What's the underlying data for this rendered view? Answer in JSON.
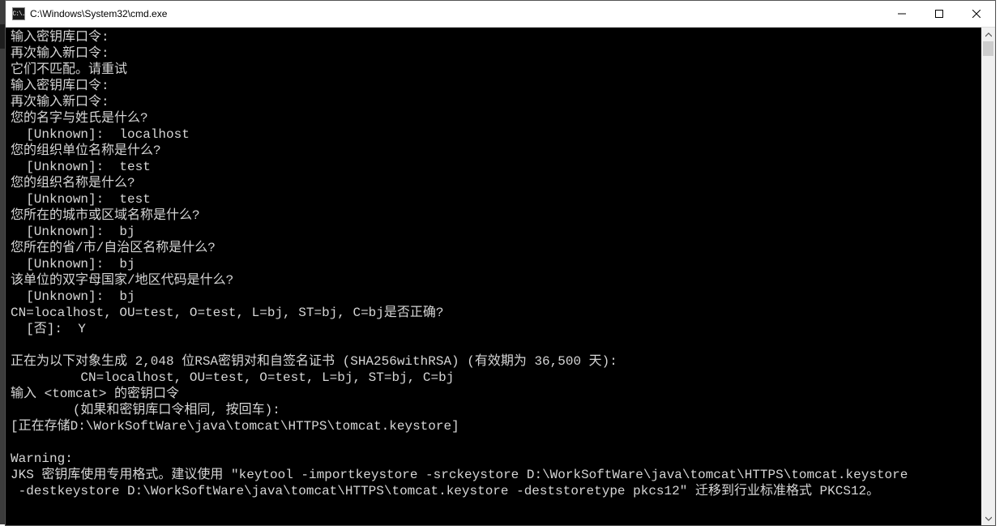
{
  "window": {
    "title": "C:\\Windows\\System32\\cmd.exe",
    "icon_label": "C:\\."
  },
  "terminal": {
    "lines": [
      "输入密钥库口令:",
      "再次输入新口令:",
      "它们不匹配。请重试",
      "输入密钥库口令:",
      "再次输入新口令:",
      "您的名字与姓氏是什么?",
      "  [Unknown]:  localhost",
      "您的组织单位名称是什么?",
      "  [Unknown]:  test",
      "您的组织名称是什么?",
      "  [Unknown]:  test",
      "您所在的城市或区域名称是什么?",
      "  [Unknown]:  bj",
      "您所在的省/市/自治区名称是什么?",
      "  [Unknown]:  bj",
      "该单位的双字母国家/地区代码是什么?",
      "  [Unknown]:  bj",
      "CN=localhost, OU=test, O=test, L=bj, ST=bj, C=bj是否正确?",
      "  [否]:  Y",
      "",
      "正在为以下对象生成 2,048 位RSA密钥对和自签名证书 (SHA256withRSA) (有效期为 36,500 天):",
      "         CN=localhost, OU=test, O=test, L=bj, ST=bj, C=bj",
      "输入 <tomcat> 的密钥口令",
      "        (如果和密钥库口令相同, 按回车):",
      "[正在存储D:\\WorkSoftWare\\java\\tomcat\\HTTPS\\tomcat.keystore]",
      "",
      "Warning:",
      "JKS 密钥库使用专用格式。建议使用 \"keytool -importkeystore -srckeystore D:\\WorkSoftWare\\java\\tomcat\\HTTPS\\tomcat.keystore",
      " -destkeystore D:\\WorkSoftWare\\java\\tomcat\\HTTPS\\tomcat.keystore -deststoretype pkcs12\" 迁移到行业标准格式 PKCS12。",
      ""
    ]
  }
}
